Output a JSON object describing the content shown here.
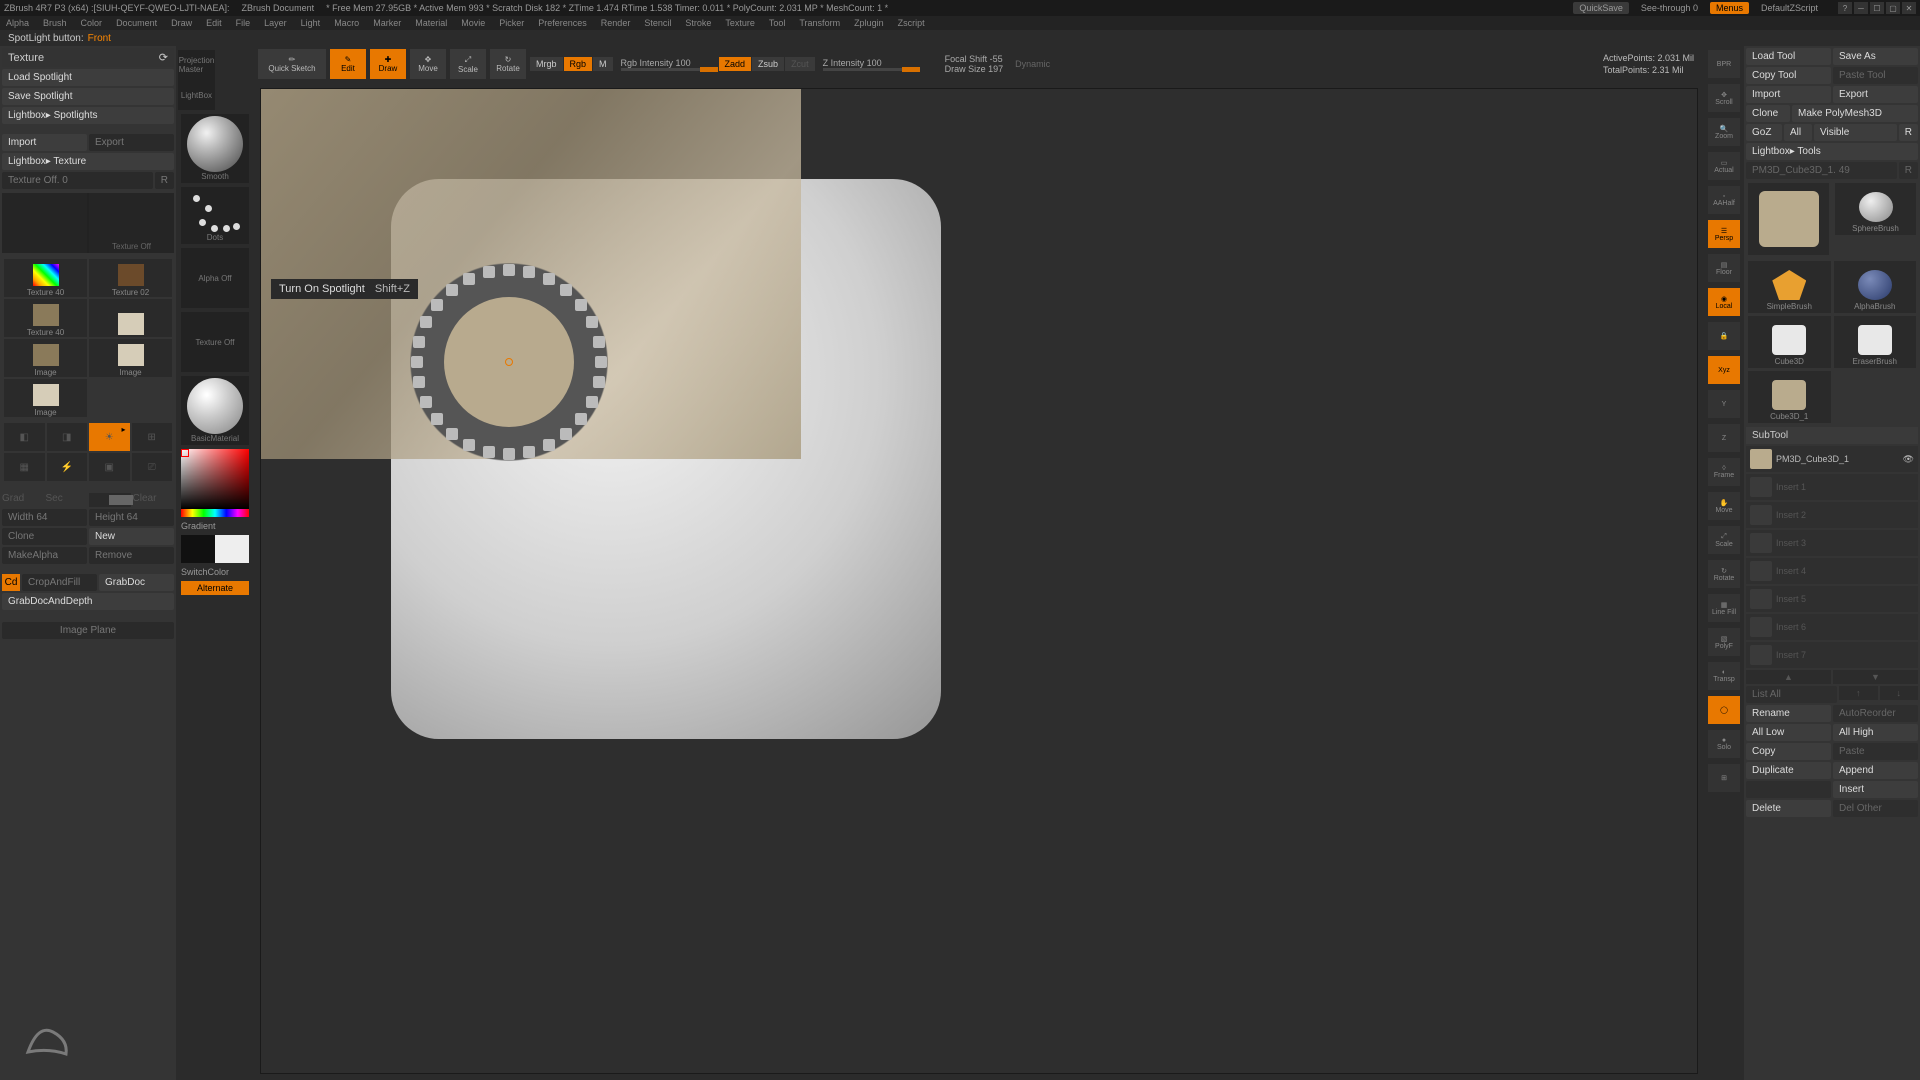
{
  "titlebar": {
    "app": "ZBrush 4R7 P3 (x64) :[SIUH-QEYF-QWEO-LJTI-NAEA]:",
    "doc": "ZBrush Document",
    "stats": "* Free Mem 27.95GB * Active Mem 993 * Scratch Disk 182 * ZTime 1.474 RTime 1.538 Timer: 0.011 * PolyCount: 2.031 MP * MeshCount: 1 *",
    "quicksave": "QuickSave",
    "seethrough": "See-through  0",
    "menus": "Menus",
    "script": "DefaultZScript"
  },
  "menu": [
    "Alpha",
    "Brush",
    "Color",
    "Document",
    "Draw",
    "Edit",
    "File",
    "Layer",
    "Light",
    "Macro",
    "Marker",
    "Material",
    "Movie",
    "Picker",
    "Preferences",
    "Render",
    "Stencil",
    "Stroke",
    "Texture",
    "Tool",
    "Transform",
    "Zplugin",
    "Zscript"
  ],
  "status": {
    "label": "SpotLight button:",
    "value": "Front"
  },
  "left": {
    "header": "Texture",
    "load": "Load Spotlight",
    "save": "Save Spotlight",
    "lbspot": "Lightbox▸ Spotlights",
    "import": "Import",
    "export": "Export",
    "lbtex": "Lightbox▸ Texture",
    "texoff": "Texture Off. 0",
    "r": "R",
    "prevlabel": "Texture Off",
    "thumbs": [
      {
        "n": "Texture 40",
        "c": "rainbow"
      },
      {
        "n": "Texture 02",
        "c": "brown"
      },
      {
        "n": "Texture 40",
        "c": "stone"
      },
      {
        "n": "",
        "c": "beige"
      },
      {
        "n": "Image",
        "c": "stone"
      },
      {
        "n": "Image",
        "c": "beige"
      },
      {
        "n": "Image",
        "c": "beige"
      }
    ],
    "grad": "Grad",
    "sec": "Sec",
    "clear": "Clear",
    "width": "Width 64",
    "height": "Height 64",
    "clone": "Clone",
    "new": "New",
    "makealpha": "MakeAlpha",
    "remove": "Remove",
    "cd": "Cd",
    "crop": "CropAndFill",
    "grab": "GrabDoc",
    "grabd": "GrabDocAndDepth",
    "imgplane": "Image Plane"
  },
  "leftdock": {
    "proj": "Projection Master",
    "lightbox": "LightBox",
    "smooth": "Smooth",
    "dots": "Dots",
    "alphaoff": "Alpha Off",
    "texoff": "Texture Off",
    "basic": "BasicMaterial",
    "gradient": "Gradient",
    "switch": "SwitchColor",
    "alt": "Alternate"
  },
  "toolbar": {
    "quick": "Quick Sketch",
    "edit": "Edit",
    "draw": "Draw",
    "move": "Move",
    "scale": "Scale",
    "rotate": "Rotate",
    "mrgb": "Mrgb",
    "rgb": "Rgb",
    "m": "M",
    "rgbint": "Rgb Intensity 100",
    "zadd": "Zadd",
    "zsub": "Zsub",
    "zcut": "Zcut",
    "zint": "Z Intensity 100",
    "focal": "Focal Shift -55",
    "drawsize": "Draw Size 197",
    "dynamic": "Dynamic",
    "active": "ActivePoints: 2.031 Mil",
    "total": "TotalPoints: 2.31 Mil"
  },
  "tooltip": {
    "label": "Turn On Spotlight",
    "shortcut": "Shift+Z"
  },
  "rightdock": [
    "BPR",
    "Scroll",
    "Zoom",
    "Actual",
    "AAHalf",
    "Persp",
    "Floor",
    "Local",
    "Xyz",
    "",
    "",
    "Frame",
    "Move",
    "Scale",
    "Rotate",
    "Line Fill",
    "PolyF",
    "Transp",
    "",
    "Solo",
    ""
  ],
  "right": {
    "load": "Load Tool",
    "save": "Save As",
    "copy": "Copy Tool",
    "paste": "Paste Tool",
    "import": "Import",
    "export": "Export",
    "clone": "Clone",
    "make": "Make PolyMesh3D",
    "goz": "GoZ",
    "all": "All",
    "visible": "Visible",
    "r": "R",
    "lbtools": "Lightbox▸ Tools",
    "toolname": "PM3D_Cube3D_1. 49",
    "tr": "R",
    "tools": [
      {
        "n": "PM3D_Cube3D_1",
        "c": "#b9ab8d"
      },
      {
        "n": "SphereBrush",
        "c": "#cfcfcf"
      },
      {
        "n": "SimpleBrush",
        "c": "#e8a030"
      },
      {
        "n": "AlphaBrush",
        "c": "#4a5a8a"
      },
      {
        "n": "Cube3D",
        "c": "#e8e8e8"
      },
      {
        "n": "EraserBrush",
        "c": "#e8e8e8"
      },
      {
        "n": "Cube3D_1",
        "c": "#e8e8e8"
      },
      {
        "n": "",
        "c": "#b9ab8d"
      }
    ],
    "subtool": "SubTool",
    "st_active": "PM3D_Cube3D_1",
    "st": [
      "Insert 1",
      "Insert 2",
      "Insert 3",
      "Insert 4",
      "Insert 5",
      "Insert 6",
      "Insert 7"
    ],
    "listall": "List All",
    "rename": "Rename",
    "autoreorder": "AutoReorder",
    "alllow": "All Low",
    "allhigh": "All High",
    "copy2": "Copy",
    "paste2": "Paste",
    "dup": "Duplicate",
    "append": "Append",
    "insert": "Insert",
    "delete": "Delete",
    "delother": "Del Other"
  }
}
